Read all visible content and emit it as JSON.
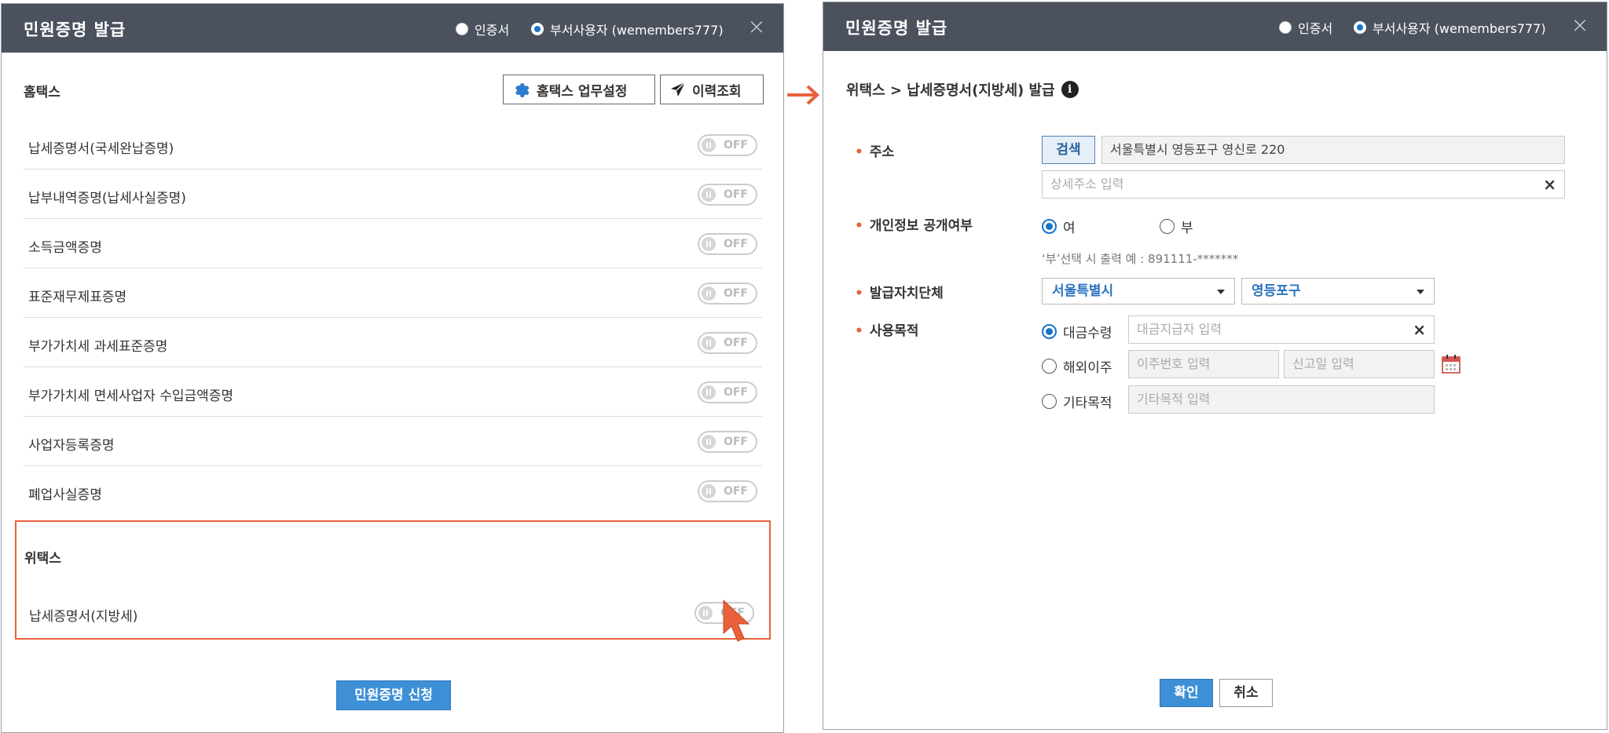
{
  "left_dialog": {
    "title": "민원증명 발급",
    "radio_options": [
      {
        "label": "인증서",
        "checked": false
      },
      {
        "label": "부서사용자 (wemembers777)",
        "checked": true
      }
    ],
    "close_icon": "close-icon",
    "hometax": {
      "section_title": "홈택스",
      "settings_button": "홈택스 업무설정",
      "history_button": "이력조회",
      "items": [
        {
          "label": "납세증명서(국세완납증명)",
          "toggle": "OFF"
        },
        {
          "label": "납부내역증명(납세사실증명)",
          "toggle": "OFF"
        },
        {
          "label": "소득금액증명",
          "toggle": "OFF"
        },
        {
          "label": "표준재무제표증명",
          "toggle": "OFF"
        },
        {
          "label": "부가가치세 과세표준증명",
          "toggle": "OFF"
        },
        {
          "label": "부가가치세 면세사업자 수입금액증명",
          "toggle": "OFF"
        },
        {
          "label": "사업자등록증명",
          "toggle": "OFF"
        },
        {
          "label": "폐업사실증명",
          "toggle": "OFF"
        }
      ]
    },
    "wetax": {
      "section_title": "위택스",
      "items": [
        {
          "label": "납세증명서(지방세)",
          "toggle": "OFF"
        }
      ]
    },
    "submit_button": "민원증명 신청"
  },
  "right_dialog": {
    "title": "민원증명 발급",
    "radio_options": [
      {
        "label": "인증서",
        "checked": false
      },
      {
        "label": "부서사용자 (wemembers777)",
        "checked": true
      }
    ],
    "breadcrumb": "위택스 > 납세증명서(지방세) 발급",
    "info_icon_glyph": "i",
    "address": {
      "label": "주소",
      "search_button": "검색",
      "value": "서울특별시 영등포구 영신로 220",
      "detail_placeholder": "상세주소 입력"
    },
    "privacy": {
      "label": "개인정보 공개여부",
      "options": [
        {
          "label": "여",
          "checked": true
        },
        {
          "label": "부",
          "checked": false
        }
      ],
      "hint": "‘부’선택 시 출력 예 : 891111-*******"
    },
    "issuing_authority": {
      "label": "발급자치단체",
      "city": "서울특별시",
      "district": "영등포구"
    },
    "purpose": {
      "label": "사용목적",
      "options": [
        {
          "label": "대금수령",
          "checked": true,
          "placeholders": [
            "대금지급자 입력"
          ]
        },
        {
          "label": "해외이주",
          "checked": false,
          "placeholders": [
            "이주번호 입력",
            "신고일 입력"
          ]
        },
        {
          "label": "기타목적",
          "checked": false,
          "placeholders": [
            "기타목적 입력"
          ]
        }
      ]
    },
    "confirm_button": "확인",
    "cancel_button": "취소"
  },
  "colors": {
    "titlebar": "#4b525e",
    "accent": "#3d8fd6",
    "highlight": "#e8613a"
  }
}
